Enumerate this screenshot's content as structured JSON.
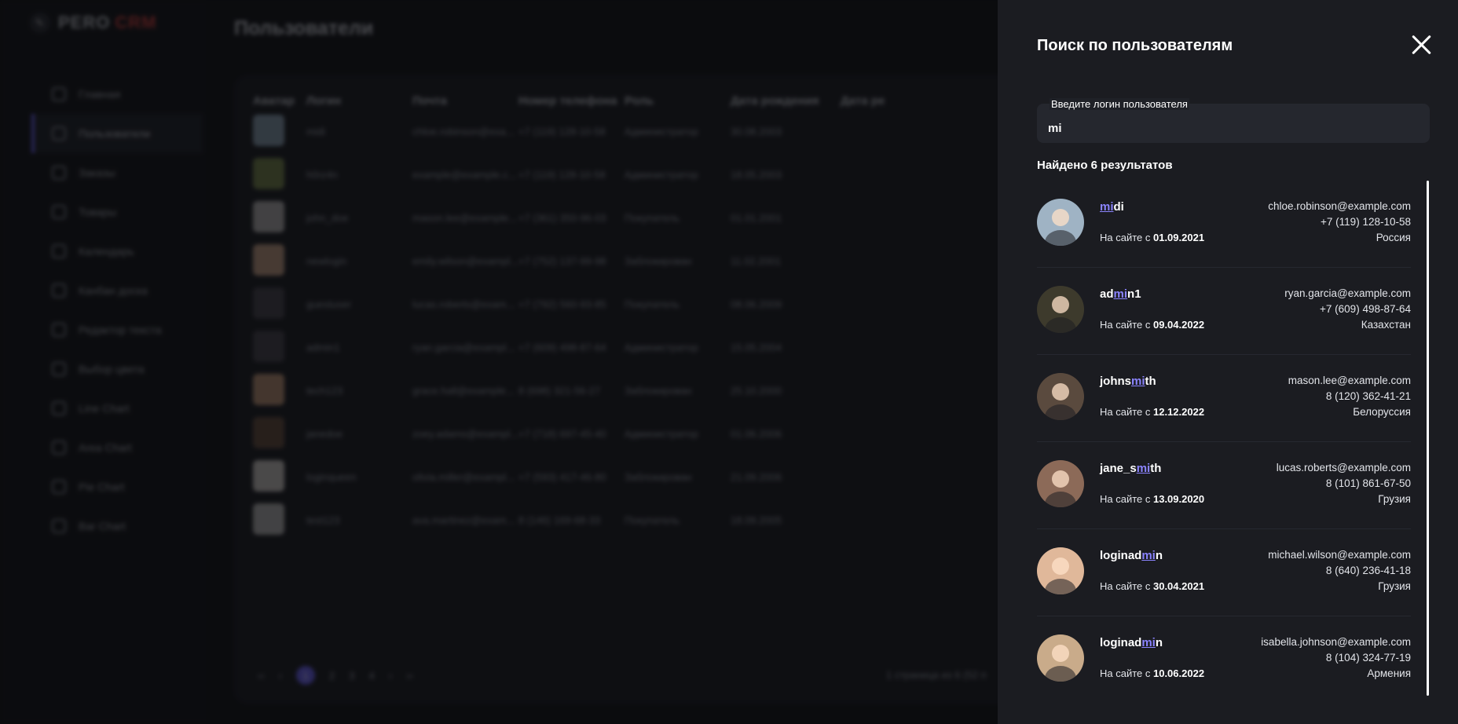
{
  "app": {
    "logo_a": "PERO",
    "logo_b": "CRM",
    "page_title": "Пользователи",
    "nav": [
      {
        "label": "Главная",
        "icon": "dashboard-icon",
        "active": false
      },
      {
        "label": "Пользователи",
        "icon": "users-icon",
        "active": true
      },
      {
        "label": "Заказы",
        "icon": "truck-icon",
        "active": false
      },
      {
        "label": "Товары",
        "icon": "box-icon",
        "active": false
      },
      {
        "label": "Календарь",
        "icon": "calendar-icon",
        "active": false
      },
      {
        "label": "Канбан доска",
        "icon": "kanban-icon",
        "active": false
      },
      {
        "label": "Редактор текста",
        "icon": "edit-icon",
        "active": false
      },
      {
        "label": "Выбор цвета",
        "icon": "palette-icon",
        "active": false
      },
      {
        "label": "Line Chart",
        "icon": "line-chart-icon",
        "active": false
      },
      {
        "label": "Area Chart",
        "icon": "area-chart-icon",
        "active": false
      },
      {
        "label": "Pie Chart",
        "icon": "pie-chart-icon",
        "active": false
      },
      {
        "label": "Bar Chart",
        "icon": "bar-chart-icon",
        "active": false
      }
    ],
    "table": {
      "headers": [
        "Аватар",
        "Логин",
        "Почта",
        "Номер телефона",
        "Роль",
        "Дата рождения",
        "Дата ре"
      ],
      "rows": [
        [
          "midi",
          "chloe.robinson@exa...",
          "+7 (119) 128-10-58",
          "Администратор",
          "30.08.2003"
        ],
        [
          "h0rz4n",
          "example@example.c...",
          "+7 (119) 128-10-58",
          "Администратор",
          "18.05.2003"
        ],
        [
          "john_doe",
          "mason.lee@example...",
          "+7 (361) 350-96-03",
          "Покупатель",
          "01.01.2001"
        ],
        [
          "newlogin",
          "emily.wilson@exampl...",
          "+7 (752) 137-99-98",
          "Заблокирован",
          "11.02.2001"
        ],
        [
          "guestuser",
          "lucas.roberts@exam...",
          "+7 (792) 560-93-85",
          "Покупатель",
          "08.06.2009"
        ],
        [
          "admin1",
          "ryan.garcia@exampl...",
          "+7 (609) 498-87-64",
          "Администратор",
          "15.05.2004"
        ],
        [
          "tech123",
          "grace.hall@example...",
          "8 (698) 321-56-27",
          "Заблокирован",
          "25.10.2000"
        ],
        [
          "janedoe",
          "zoey.adams@exampl...",
          "+7 (718) 697-45-40",
          "Администратор",
          "01.06.2006"
        ],
        [
          "loginqueen",
          "olivia.miller@exampl...",
          "+7 (593) 417-46-80",
          "Заблокирован",
          "21.09.2006"
        ],
        [
          "test123",
          "ava.martinez@exam...",
          "8 (146) 169-68-33",
          "Покупатель",
          "18.09.2005"
        ]
      ],
      "pages": [
        "1",
        "2",
        "3",
        "4"
      ],
      "pager_info": "1 страница из 6 (52 п"
    }
  },
  "search": {
    "title": "Поиск по пользователям",
    "field_label": "Введите логин пользователя",
    "query": "mi",
    "found_text": "Найдено 6 результатов",
    "since_label": "На сайте с ",
    "results": [
      {
        "login_pre": "",
        "login_hl": "mi",
        "login_post": "di",
        "since": "01.09.2021",
        "email": "chloe.robinson@example.com",
        "phone": "+7 (119) 128-10-58",
        "country": "Россия",
        "avatar_color": "#9fb3c4"
      },
      {
        "login_pre": "ad",
        "login_hl": "mi",
        "login_post": "n1",
        "since": "09.04.2022",
        "email": "ryan.garcia@example.com",
        "phone": "+7 (609) 498-87-64",
        "country": "Казахстан",
        "avatar_color": "#3d3a2c"
      },
      {
        "login_pre": "johns",
        "login_hl": "mi",
        "login_post": "th",
        "since": "12.12.2022",
        "email": "mason.lee@example.com",
        "phone": "8 (120) 362-41-21",
        "country": "Белоруссия",
        "avatar_color": "#5a4a3e"
      },
      {
        "login_pre": "jane_s",
        "login_hl": "mi",
        "login_post": "th",
        "since": "13.09.2020",
        "email": "lucas.roberts@example.com",
        "phone": "8 (101) 861-67-50",
        "country": "Грузия",
        "avatar_color": "#8c6a58"
      },
      {
        "login_pre": "loginad",
        "login_hl": "mi",
        "login_post": "n",
        "since": "30.04.2021",
        "email": "michael.wilson@example.com",
        "phone": "8 (640) 236-41-18",
        "country": "Грузия",
        "avatar_color": "#e0b89a"
      },
      {
        "login_pre": "loginad",
        "login_hl": "mi",
        "login_post": "n",
        "since": "10.06.2022",
        "email": "isabella.johnson@example.com",
        "phone": "8 (104) 324-77-19",
        "country": "Армения",
        "avatar_color": "#c9ab8a"
      }
    ]
  }
}
